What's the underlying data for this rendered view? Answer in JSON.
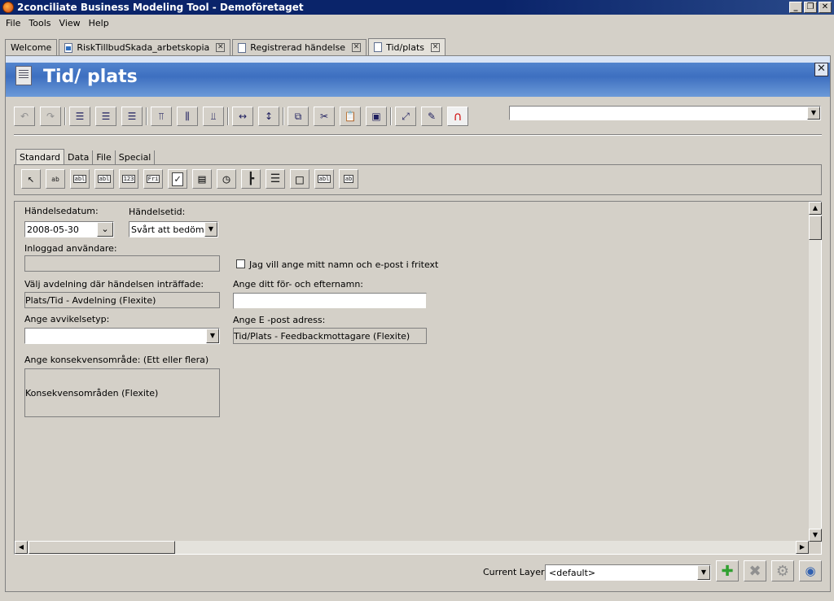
{
  "window": {
    "title": "2conciliate Business Modeling Tool - Demoföretaget",
    "controls": [
      "_",
      "❐",
      "✕"
    ]
  },
  "menu": [
    "File",
    "Tools",
    "View",
    "Help"
  ],
  "tabs": [
    {
      "label": "Welcome",
      "closable": false,
      "active": false
    },
    {
      "label": "RiskTillbudSkada_arbetskopia",
      "closable": true,
      "active": false
    },
    {
      "label": "Registrerad händelse",
      "closable": true,
      "active": false
    },
    {
      "label": "Tid/plats",
      "closable": true,
      "active": true
    }
  ],
  "header": {
    "title": "Tid/ plats",
    "close": "✕"
  },
  "toolbar": {
    "icons": [
      "undo-icon",
      "redo-icon",
      "align-left-icon",
      "align-center-icon",
      "align-right-icon",
      "align-top-icon",
      "align-middle-icon",
      "align-bottom-icon",
      "same-width-icon",
      "same-height-icon",
      "copy-icon",
      "cut-icon",
      "paste-icon",
      "paste-special-icon",
      "connect-icon",
      "edit-icon",
      "magnet-icon"
    ],
    "combo_value": ""
  },
  "palette": {
    "tabs": [
      "Standard",
      "Data",
      "File",
      "Special"
    ],
    "tools": [
      {
        "name": "pointer-tool",
        "glyph": "↖"
      },
      {
        "name": "label-tool",
        "glyph": "ab"
      },
      {
        "name": "textfield-tool",
        "glyph": "abl"
      },
      {
        "name": "textarea-tool",
        "glyph": "abl"
      },
      {
        "name": "number-tool",
        "glyph": "123"
      },
      {
        "name": "freetext-tool",
        "glyph": "Fri"
      },
      {
        "name": "checkbox-tool",
        "glyph": "✓"
      },
      {
        "name": "list-tool",
        "glyph": "▤"
      },
      {
        "name": "time-tool",
        "glyph": "◷"
      },
      {
        "name": "tree-tool",
        "glyph": "┣"
      },
      {
        "name": "listbox-tool",
        "glyph": "☰"
      },
      {
        "name": "panel-tool",
        "glyph": "□"
      },
      {
        "name": "labelfield-tool",
        "glyph": "abl"
      },
      {
        "name": "grid-tool",
        "glyph": "ab"
      }
    ]
  },
  "form": {
    "date_label": "Händelsedatum:",
    "date_value": "2008-05-30",
    "time_label": "Händelsetid:",
    "time_value": "Svårt att bedöma",
    "user_label": "Inloggad användare:",
    "user_value": "",
    "dept_label": "Välj avdelning där händelsen inträffade:",
    "dept_value": "Plats/Tid - Avdelning (Flexite)",
    "type_label": "Ange avvikelsetyp:",
    "type_value": "",
    "area_label": "Ange konsekvensområde: (Ett eller flera)",
    "area_value": "Konsekvensområden (Flexite)",
    "checkbox_label": "Jag vill ange mitt namn och e-post i fritext",
    "name_label": "Ange ditt för- och efternamn:",
    "name_value": "",
    "email_label": "Ange E -post adress:",
    "email_value": "Tid/Plats - Feedbackmottagare (Flexite)"
  },
  "bottom": {
    "layer_label": "Current Layer:",
    "layer_value": "<default>"
  },
  "colors": {
    "title_bar": "#0a246a",
    "header_blue": "#3d6fc0",
    "add_green": "#30a030"
  }
}
